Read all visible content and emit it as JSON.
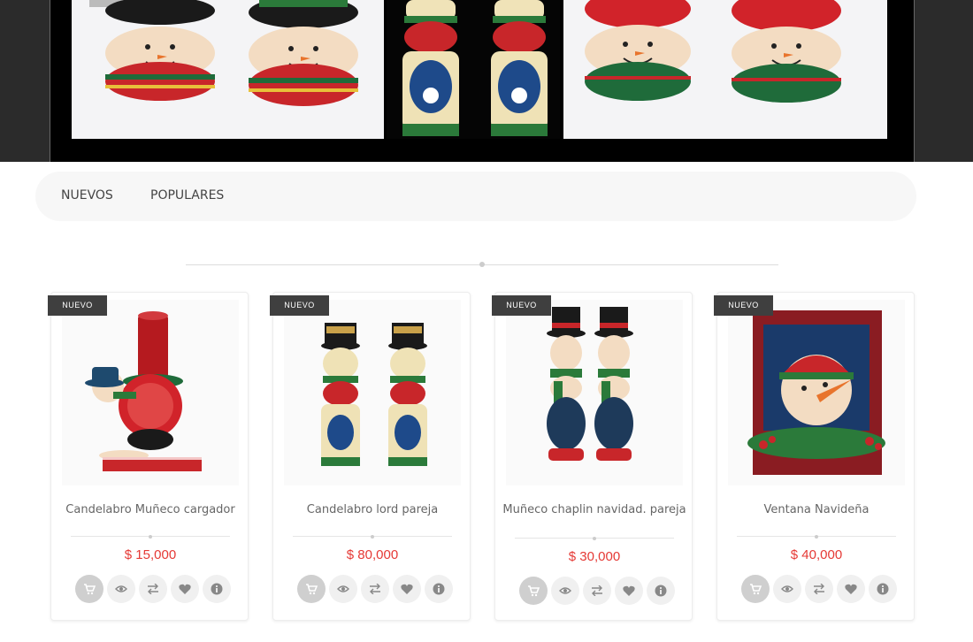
{
  "tabs": [
    {
      "label": "NUEVOS"
    },
    {
      "label": "POPULARES"
    }
  ],
  "products": [
    {
      "badge": "NUEVO",
      "name": "Candelabro Muñeco cargador",
      "price": "$ 15,000"
    },
    {
      "badge": "NUEVO",
      "name": "Candelabro lord pareja",
      "price": "$ 80,000"
    },
    {
      "badge": "NUEVO",
      "name": "Muñeco chaplin navidad. pareja",
      "price": "$ 30,000"
    },
    {
      "badge": "NUEVO",
      "name": "Ventana Navideña",
      "price": "$ 40,000"
    }
  ],
  "product_actions": [
    "cart-icon",
    "eye-icon",
    "compare-icon",
    "heart-icon",
    "info-icon"
  ],
  "colors": {
    "price": "#e53935",
    "badge_bg": "#3f3f3f",
    "hero_bg": "#2b2b2b",
    "tabs_bg": "#f7f7f7"
  }
}
